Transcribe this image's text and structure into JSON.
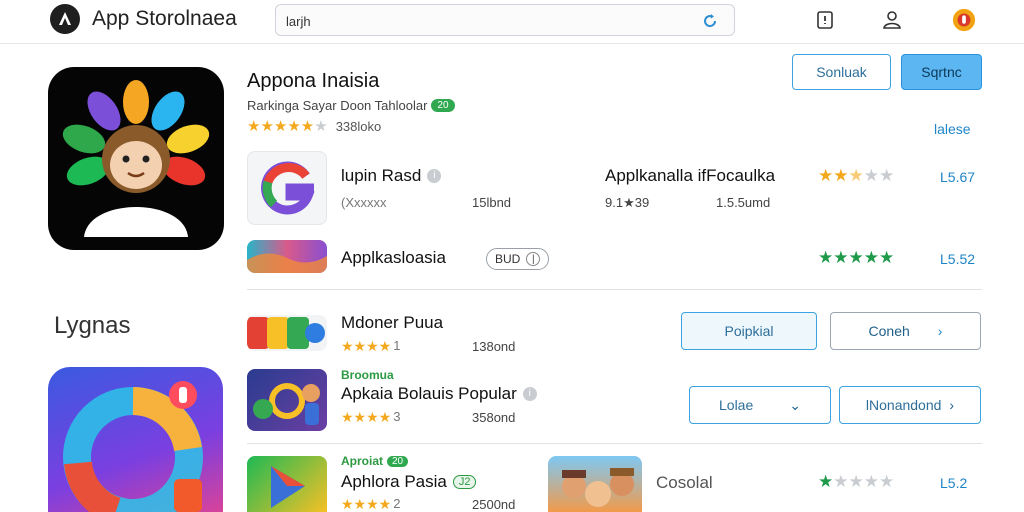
{
  "header": {
    "app_title": "App Storolnaea",
    "search_value": "larjh",
    "logo_icon": "app-store-logo",
    "icons": [
      "bookmark-icon",
      "account-icon",
      "notification-icon"
    ]
  },
  "featured": {
    "title": "Appona Inaisia",
    "subtitle": "Rarkinga Sayar Doon Tahloolar",
    "subtitle_badge": "20",
    "rating_stars": 5,
    "rating_text": "338loko",
    "buttons": {
      "secondary": "Sonluak",
      "primary": "Sqrtnc"
    },
    "link": "lalese"
  },
  "rows": [
    {
      "name": "lupin Rasd",
      "meta_left": "(Xxxxxx",
      "meta_right": "15lbnd"
    },
    {
      "name": "Applkanalla ifFocaulka",
      "meta_left": "9.1★39",
      "meta_right": "1.5.5umd",
      "stars": 3,
      "rating": "L5.67"
    },
    {
      "name": "Applkasloasia",
      "chip": "BUD",
      "stars": 5,
      "rating": "L5.52"
    }
  ],
  "section": {
    "label": "Lygnas",
    "items": [
      {
        "name": "Mdoner Puua",
        "stars": 4,
        "stars_suffix": "1",
        "meta": "138ond",
        "button": "Poipkial",
        "button2": "Coneh"
      },
      {
        "tag": "Broomua",
        "name": "Apkaia Bolauis Popular",
        "stars": 4,
        "stars_suffix": "3",
        "meta": "358ond",
        "button": "Lolae",
        "button2": "lNonandond"
      },
      {
        "tag": "Aproiat",
        "tag_badge": "20",
        "name": "Aphlora Pasia",
        "name_badge": "J2",
        "stars": 4,
        "stars_suffix": "2",
        "meta": "2500nd",
        "side_label": "Cosolal",
        "rating_stars": 1,
        "rating": "L5.2"
      }
    ]
  },
  "colors": {
    "accent": "#3da3e0",
    "star": "#f4a81d",
    "star_green": "#1f9a4a",
    "link": "#1f86c8"
  }
}
